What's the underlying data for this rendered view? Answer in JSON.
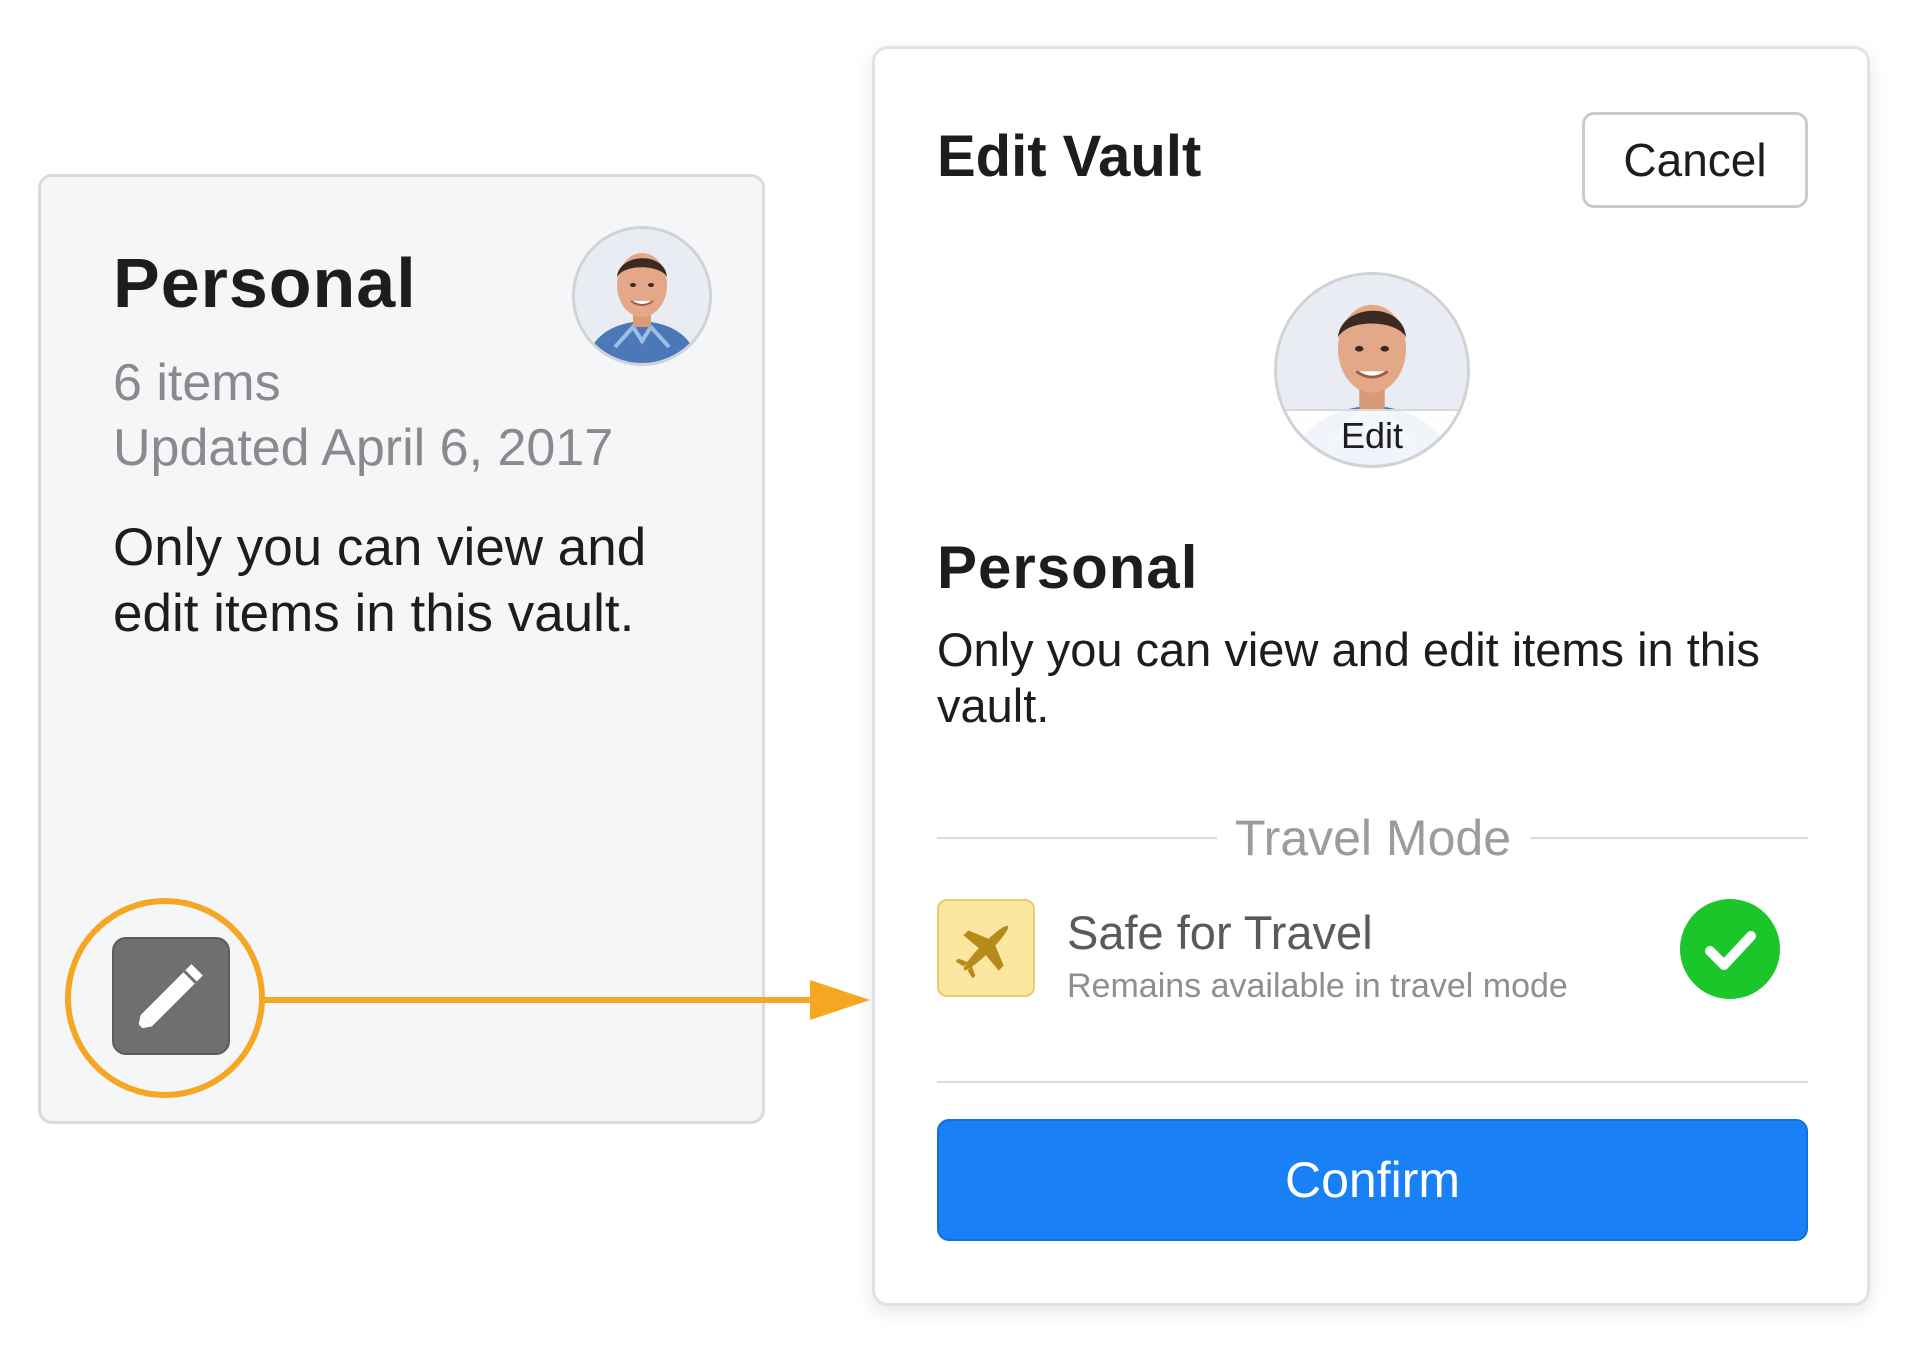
{
  "vault_card": {
    "title": "Personal",
    "item_count": "6 items",
    "updated": "Updated April 6, 2017",
    "description": "Only you can view and edit items in this vault.",
    "avatar_icon": "user-photo",
    "edit_icon": "pencil-icon"
  },
  "edit_vault": {
    "title": "Edit Vault",
    "cancel_label": "Cancel",
    "avatar_edit_label": "Edit",
    "vault_name": "Personal",
    "vault_description": "Only you can view and edit items in this vault.",
    "travel_mode": {
      "section_label": "Travel Mode",
      "title": "Safe for Travel",
      "subtitle": "Remains available in travel mode",
      "icon": "airplane-icon",
      "checked": true
    },
    "confirm_label": "Confirm"
  },
  "colors": {
    "accent_blue": "#1a80f5",
    "highlight_orange": "#f5a623",
    "check_green": "#1bc62b",
    "travel_icon_bg": "#fbe7a0"
  }
}
